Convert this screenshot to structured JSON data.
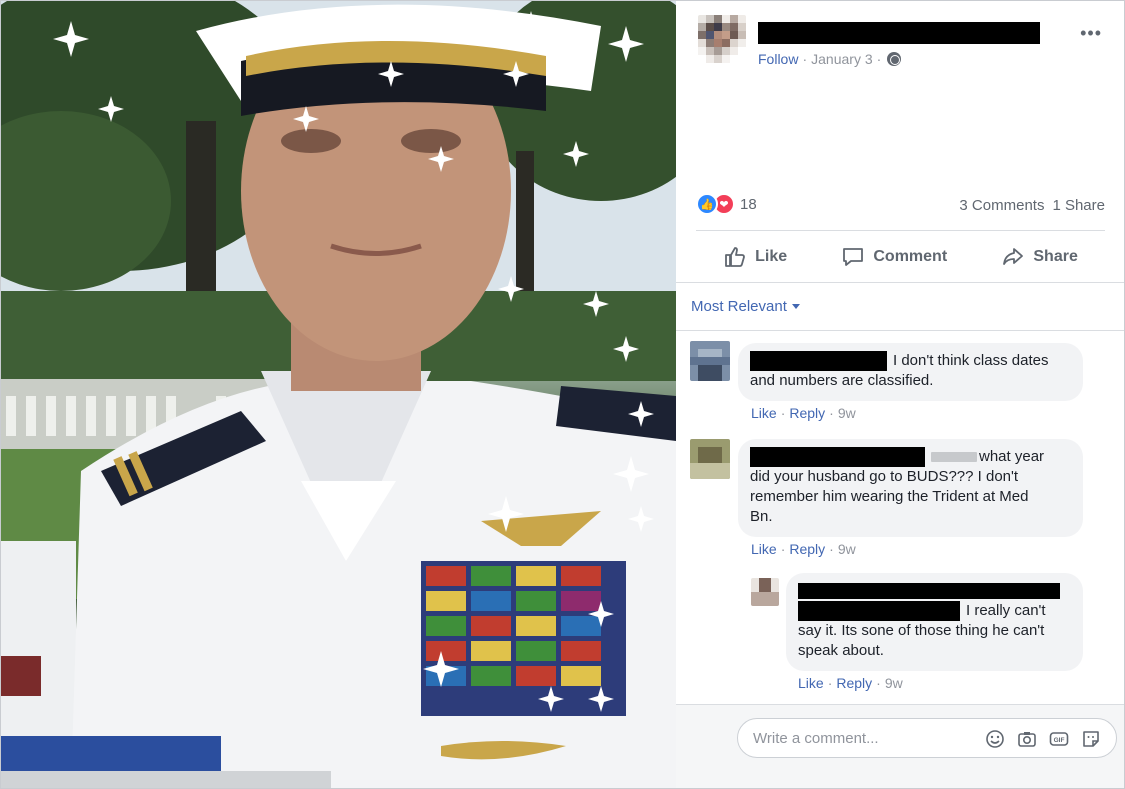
{
  "post": {
    "follow_label": "Follow",
    "sep1": "·",
    "date": "January 3",
    "sep2": "·",
    "more_label": "•••",
    "reaction_count": "18",
    "comments_count": "3 Comments",
    "shares_count": "1 Share",
    "like_label": "Like",
    "comment_label": "Comment",
    "share_label": "Share"
  },
  "sort_label": "Most Relevant",
  "comments": [
    {
      "lines": [
        "I don't think class dates",
        "and numbers are classified."
      ],
      "like": "Like",
      "reply": "Reply",
      "time": "9w",
      "sep": "·"
    },
    {
      "lines": [
        "what year",
        "did your husband go to BUDS??? I don't",
        "remember him wearing the Trident at Med",
        "Bn."
      ],
      "like": "Like",
      "reply": "Reply",
      "time": "9w",
      "sep": "·"
    },
    {
      "lines": [
        "I really can't",
        "say it. Its sone of those thing he can't",
        "speak about."
      ],
      "like": "Like",
      "reply": "Reply",
      "time": "9w",
      "sep": "·"
    }
  ],
  "composer": {
    "placeholder": "Write a comment...",
    "icons": [
      "emoji-icon",
      "camera-icon",
      "gif-icon",
      "sticker-icon"
    ]
  },
  "colors": {
    "link": "#4267b2",
    "meta": "#90949c",
    "bubble": "#f2f3f5",
    "like_reaction": "#2d88ff",
    "love_reaction": "#f33e58"
  }
}
